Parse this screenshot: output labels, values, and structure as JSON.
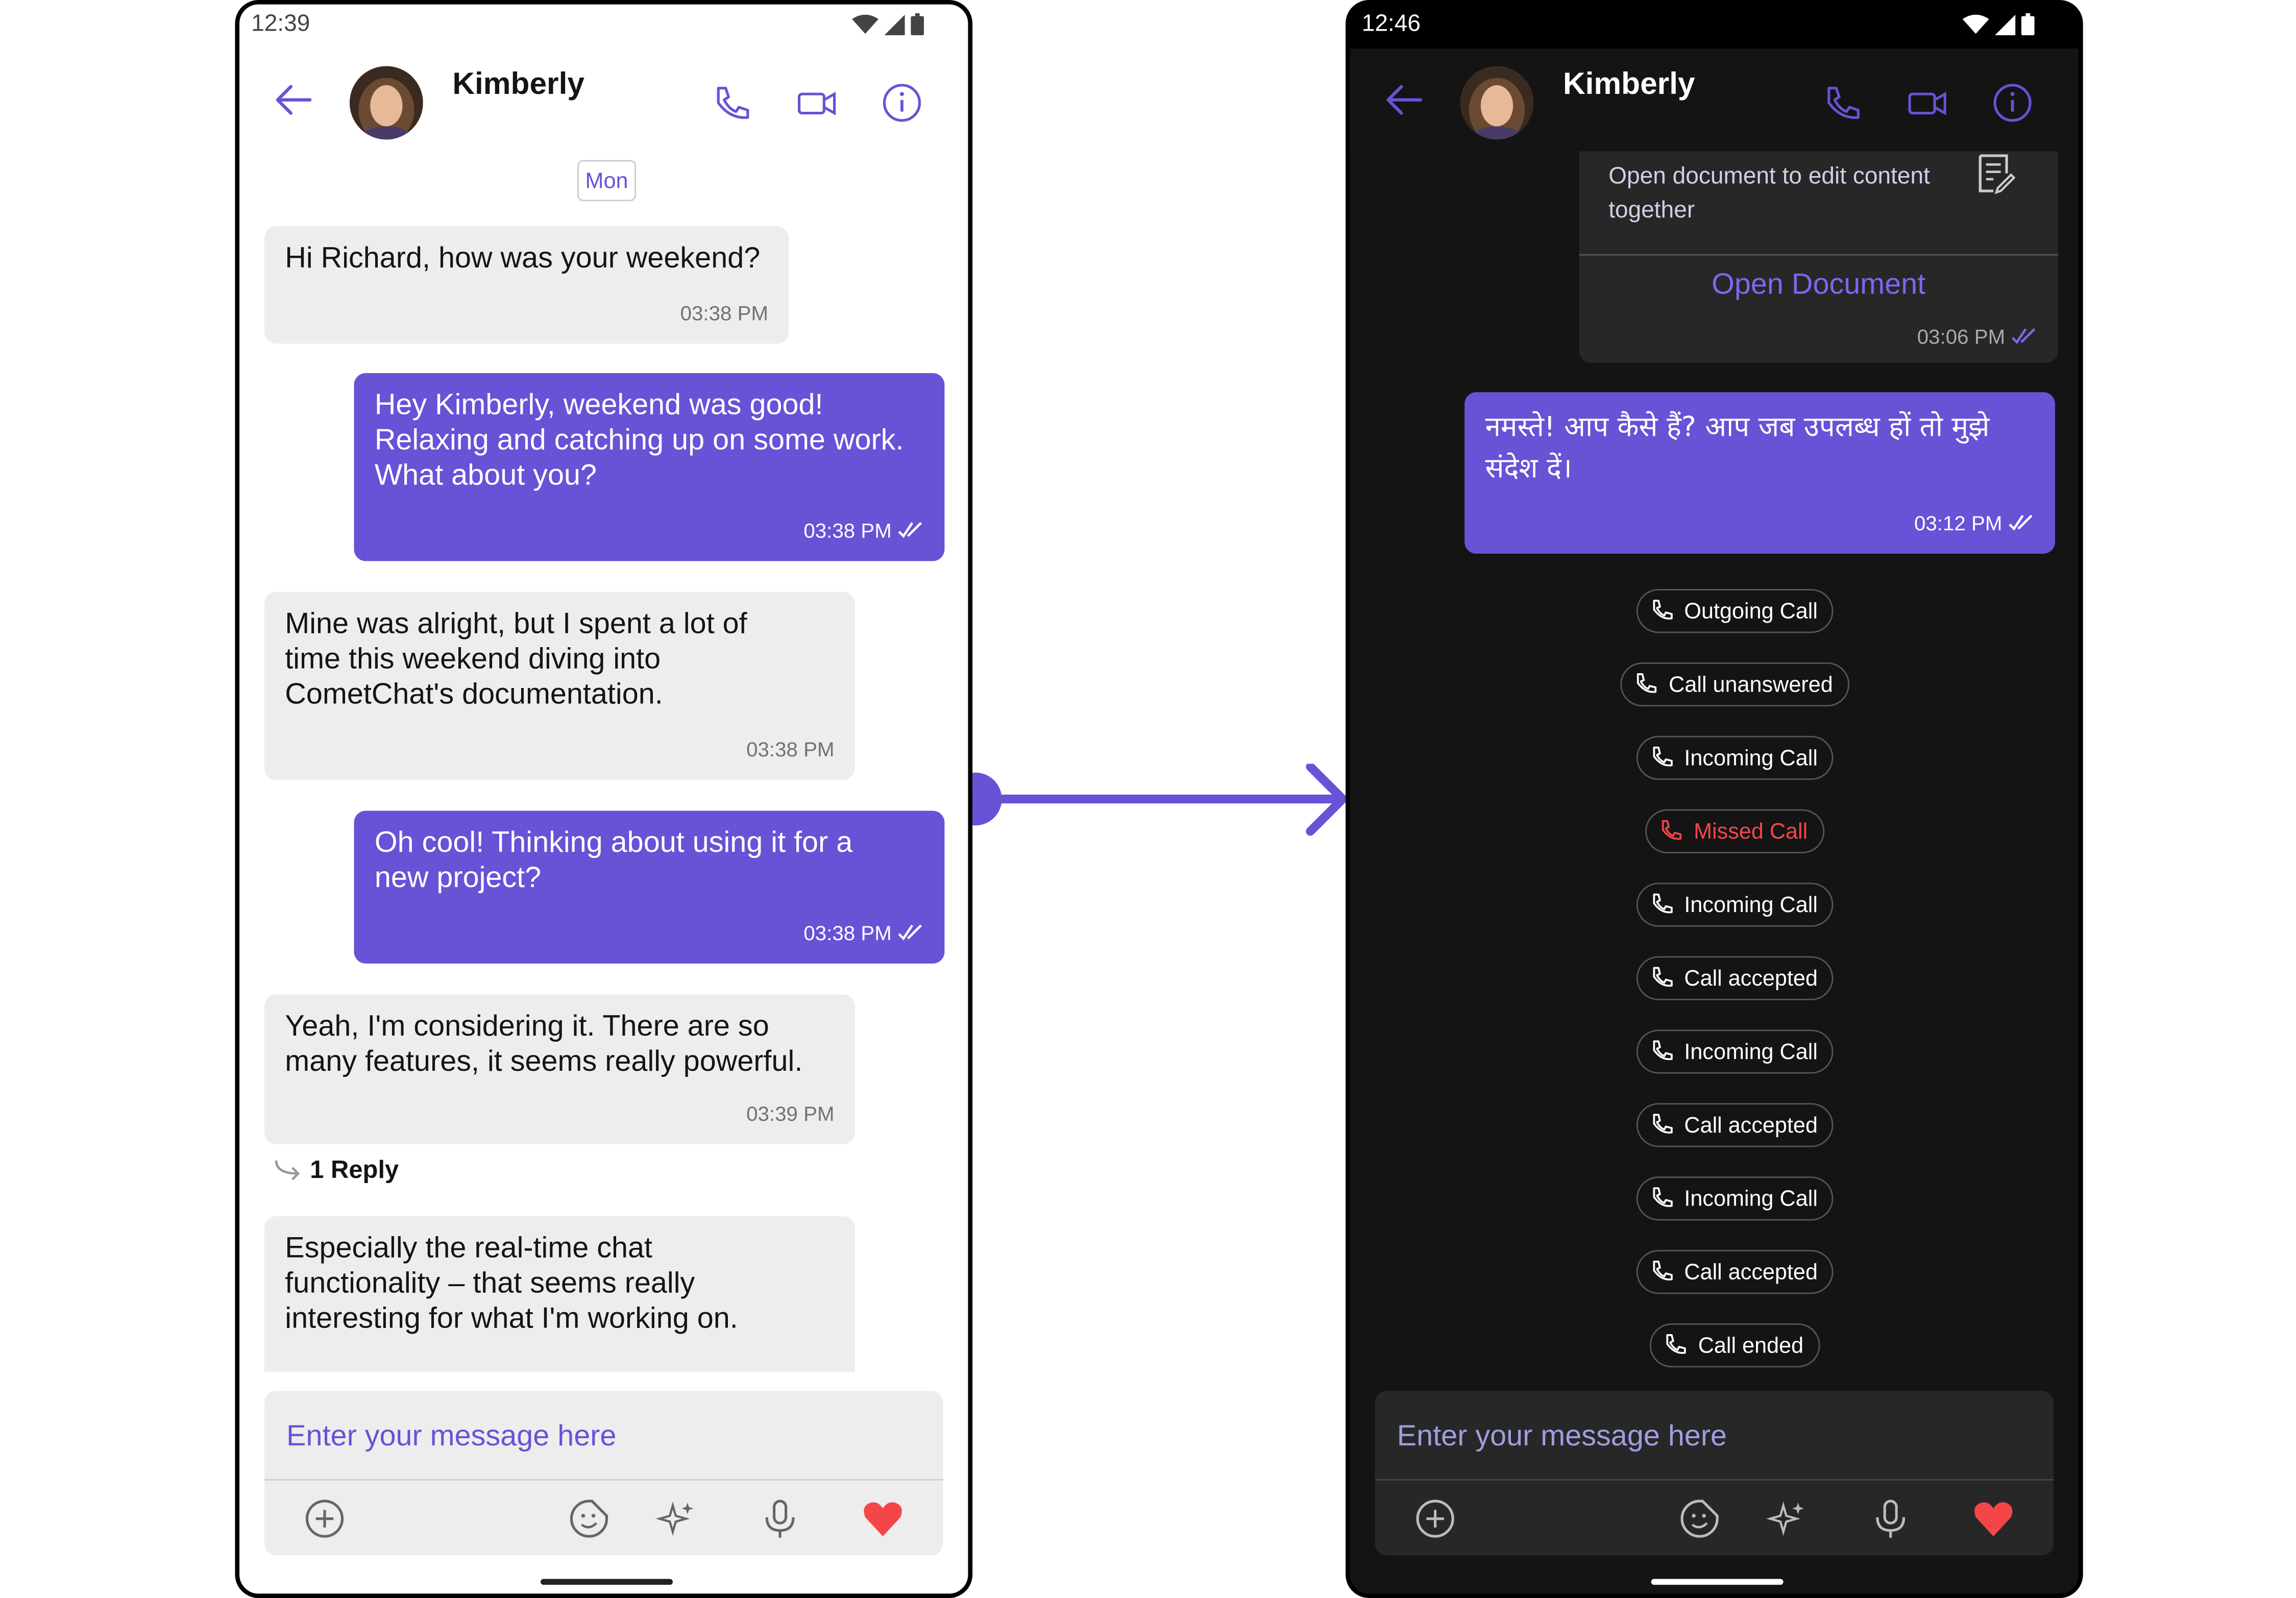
{
  "light": {
    "status_time": "12:39",
    "contact_name": "Kimberly",
    "date_chip": "Mon",
    "messages": [
      {
        "text": "Hi Richard, how was your weekend?",
        "time": "03:38 PM"
      },
      {
        "text": "Hey Kimberly, weekend was good!\nRelaxing and catching up on some work.\nWhat about you?",
        "time": "03:38 PM"
      },
      {
        "text": "Mine was alright, but I spent a lot of\ntime this weekend diving into\nCometChat's documentation.",
        "time": "03:38 PM"
      },
      {
        "text": "Oh cool! Thinking about using it for a\nnew project?",
        "time": "03:38 PM"
      },
      {
        "text": "Yeah, I'm considering it.  There are so\nmany features, it seems really powerful.",
        "time": "03:39 PM"
      },
      {
        "text": "Especially the real-time chat\nfunctionality – that seems really\ninteresting for what I'm working on.",
        "time": ""
      }
    ],
    "reply_count": "1 Reply",
    "composer_placeholder": "Enter your message here"
  },
  "dark": {
    "status_time": "12:46",
    "contact_name": "Kimberly",
    "document_card": {
      "description": "Open document to edit content together",
      "action": "Open Document",
      "time": "03:06 PM"
    },
    "hindi_message": {
      "text": "नमस्ते! आप कैसे हैं?  आप जब उपलब्ध हों तो मुझे संदेश दें।",
      "time": "03:12 PM"
    },
    "call_events": [
      {
        "label": "Outgoing Call",
        "status": "normal"
      },
      {
        "label": "Call unanswered",
        "status": "normal"
      },
      {
        "label": "Incoming Call",
        "status": "normal"
      },
      {
        "label": "Missed Call",
        "status": "missed"
      },
      {
        "label": "Incoming Call",
        "status": "normal"
      },
      {
        "label": "Call accepted",
        "status": "normal"
      },
      {
        "label": "Incoming Call",
        "status": "normal"
      },
      {
        "label": "Call accepted",
        "status": "normal"
      },
      {
        "label": "Incoming Call",
        "status": "normal"
      },
      {
        "label": "Call accepted",
        "status": "normal"
      },
      {
        "label": "Call ended",
        "status": "normal"
      }
    ],
    "composer_placeholder": "Enter your message here"
  },
  "colors": {
    "accent": "#6852d6",
    "missed": "#f44649",
    "heart": "#f44649"
  },
  "icons": [
    "back-arrow-icon",
    "phone-icon",
    "video-icon",
    "info-icon",
    "plus-icon",
    "sticker-icon",
    "ai-sparkle-icon",
    "microphone-icon",
    "heart-icon",
    "double-check-icon",
    "reply-arrow-icon",
    "document-icon"
  ]
}
